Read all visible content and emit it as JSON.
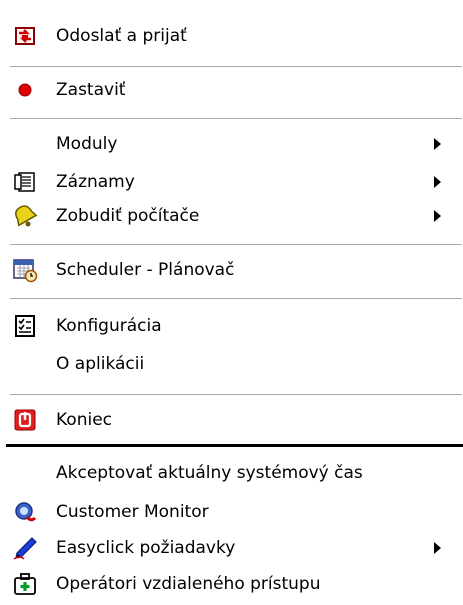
{
  "menu": {
    "items": [
      {
        "label": "Odoslať a prijať",
        "icon": "send-receive-icon"
      },
      {
        "label": "Zastaviť",
        "icon": "red-dot-stop-icon"
      },
      {
        "label": "Moduly",
        "icon": "",
        "submenu": true
      },
      {
        "label": "Záznamy",
        "icon": "records-list-icon",
        "submenu": true
      },
      {
        "label": "Zobudiť počítače",
        "icon": "wake-bell-icon",
        "submenu": true
      },
      {
        "label": "Scheduler - Plánovač",
        "icon": "calendar-clock-icon"
      },
      {
        "label": "Konfigurácia",
        "icon": "configuration-list-icon"
      },
      {
        "label": "O aplikácii",
        "icon": ""
      },
      {
        "label": "Koniec",
        "icon": "power-exit-icon"
      },
      {
        "label": "Akceptovať aktuálny systémový čas",
        "icon": ""
      },
      {
        "label": "Customer Monitor",
        "icon": "customer-monitor-icon"
      },
      {
        "label": "Easyclick požiadavky",
        "icon": "pen-icon",
        "submenu": true
      },
      {
        "label": "Operátori vzdialeného prístupu",
        "icon": "remote-operator-kit-icon"
      }
    ]
  },
  "colors": {
    "stop_red": "#e00000",
    "exit_red": "#e02020",
    "pen_blue": "#1a3fd8",
    "bell_yellow": "#e8d21a",
    "separator": "#a8a8a8"
  }
}
